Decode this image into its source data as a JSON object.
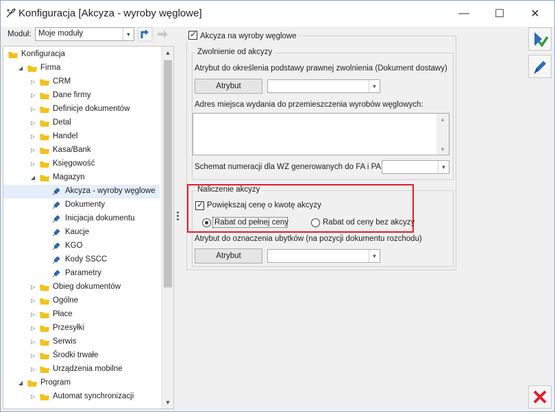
{
  "window": {
    "title": "Konfiguracja [Akcyza - wyroby węglowe]",
    "minimize": "—",
    "maximize": "☐",
    "close": "✕"
  },
  "module": {
    "label": "Moduł:",
    "value": "Moje moduły"
  },
  "tree": {
    "items": [
      {
        "label": "Konfiguracja",
        "level": 0,
        "expander": "",
        "kind": "folder"
      },
      {
        "label": "Firma",
        "level": 1,
        "expander": "◢",
        "kind": "folder"
      },
      {
        "label": "CRM",
        "level": 2,
        "expander": "▷",
        "kind": "folder"
      },
      {
        "label": "Dane firmy",
        "level": 2,
        "expander": "▷",
        "kind": "folder"
      },
      {
        "label": "Definicje dokumentów",
        "level": 2,
        "expander": "▷",
        "kind": "folder"
      },
      {
        "label": "Detal",
        "level": 2,
        "expander": "▷",
        "kind": "folder"
      },
      {
        "label": "Handel",
        "level": 2,
        "expander": "▷",
        "kind": "folder"
      },
      {
        "label": "Kasa/Bank",
        "level": 2,
        "expander": "▷",
        "kind": "folder"
      },
      {
        "label": "Księgowość",
        "level": 2,
        "expander": "▷",
        "kind": "folder"
      },
      {
        "label": "Magazyn",
        "level": 2,
        "expander": "◢",
        "kind": "folder"
      },
      {
        "label": "Akcyza - wyroby węglowe",
        "level": 3,
        "expander": "",
        "kind": "leaf",
        "selected": true
      },
      {
        "label": "Dokumenty",
        "level": 3,
        "expander": "",
        "kind": "leaf"
      },
      {
        "label": "Inicjacja dokumentu",
        "level": 3,
        "expander": "",
        "kind": "leaf"
      },
      {
        "label": "Kaucje",
        "level": 3,
        "expander": "",
        "kind": "leaf"
      },
      {
        "label": "KGO",
        "level": 3,
        "expander": "",
        "kind": "leaf"
      },
      {
        "label": "Kody SSCC",
        "level": 3,
        "expander": "",
        "kind": "leaf"
      },
      {
        "label": "Parametry",
        "level": 3,
        "expander": "",
        "kind": "leaf"
      },
      {
        "label": "Obieg dokumentów",
        "level": 2,
        "expander": "▷",
        "kind": "folder"
      },
      {
        "label": "Ogólne",
        "level": 2,
        "expander": "▷",
        "kind": "folder"
      },
      {
        "label": "Płace",
        "level": 2,
        "expander": "▷",
        "kind": "folder"
      },
      {
        "label": "Przesyłki",
        "level": 2,
        "expander": "▷",
        "kind": "folder"
      },
      {
        "label": "Serwis",
        "level": 2,
        "expander": "▷",
        "kind": "folder"
      },
      {
        "label": "Środki trwałe",
        "level": 2,
        "expander": "▷",
        "kind": "folder"
      },
      {
        "label": "Urządzenia mobilne",
        "level": 2,
        "expander": "▷",
        "kind": "folder"
      },
      {
        "label": "Program",
        "level": 1,
        "expander": "◢",
        "kind": "folder"
      },
      {
        "label": "Automat synchronizacji",
        "level": 2,
        "expander": "▷",
        "kind": "folder"
      }
    ]
  },
  "akcyza": {
    "main_checkbox": "Akcyza na wyroby węglowe",
    "main_checked": true,
    "exemption": {
      "legend": "Zwolnienie od akcyzy",
      "attr_label": "Atrybut do określenia podstawy prawnej zwolnienia (Dokument dostawy)",
      "attr_button": "Atrybut",
      "attr_value": "",
      "address_label": "Adres miejsca wydania do przemieszczenia wyrobów węglowych:",
      "address_value": "",
      "numbering_label": "Schemat numeracji dla WZ generowanych do FA i PA:",
      "numbering_value": ""
    },
    "calc": {
      "legend": "Naliczenie akcyzy",
      "increase_label": "Powiększaj cenę o kwotę akcyzy",
      "increase_checked": true,
      "radio_full": "Rabat od pełnej ceny",
      "radio_without": "Rabat od ceny bez akcyzy",
      "radio_selected": "full",
      "loss_label": "Atrybut do oznaczenia ubytków (na pozycji dokumentu rozchodu)",
      "loss_button": "Atrybut",
      "loss_value": ""
    }
  },
  "colors": {
    "highlight": "#e01d2a",
    "folder": "#f2c21b",
    "accent_blue": "#2f6db5"
  }
}
